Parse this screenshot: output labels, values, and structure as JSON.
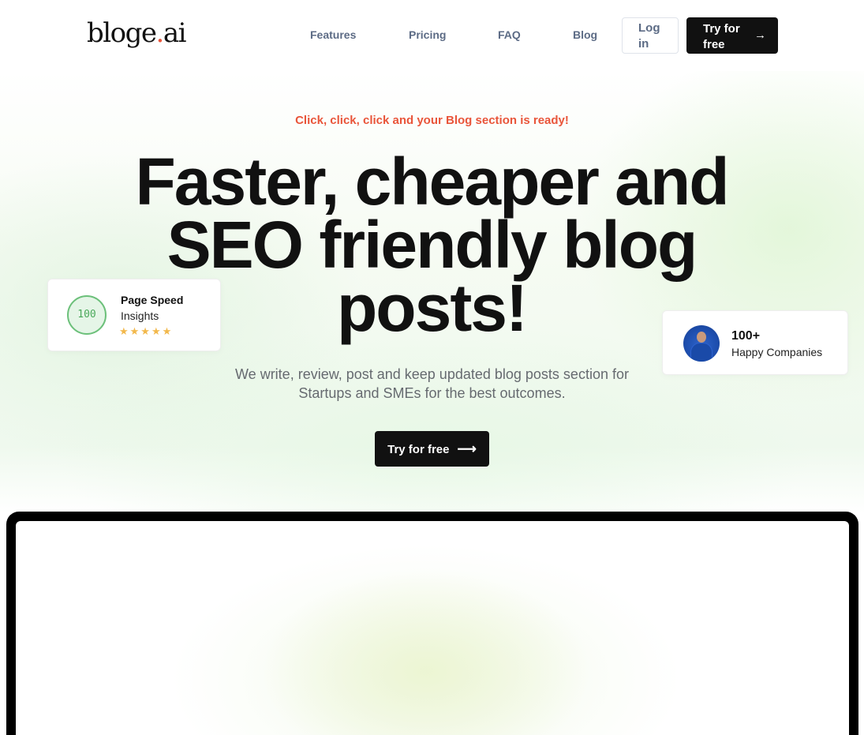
{
  "brand": {
    "logo_main": "bloge",
    "logo_dot": ".",
    "logo_tld": "ai",
    "accent_color": "#e9553a"
  },
  "nav": {
    "links": [
      "Features",
      "Pricing",
      "FAQ",
      "Blog"
    ],
    "login_label": "Log in",
    "try_label": "Try for free",
    "try_arrow": "→"
  },
  "hero": {
    "tagline": "Click, click, click and your Blog section is ready!",
    "headline": "Faster, cheaper and SEO friendly blog posts!",
    "subtext": "We write, review, post and keep updated blog posts section for Startups and SMEs for the best outcomes.",
    "cta_label": "Try for free",
    "cta_arrow": "⟶"
  },
  "speed_card": {
    "score": "100",
    "title": "Page Speed",
    "subtitle": "Insights",
    "stars": "★★★★★",
    "rating": 5
  },
  "companies_card": {
    "count": "100+",
    "label": "Happy Companies"
  }
}
